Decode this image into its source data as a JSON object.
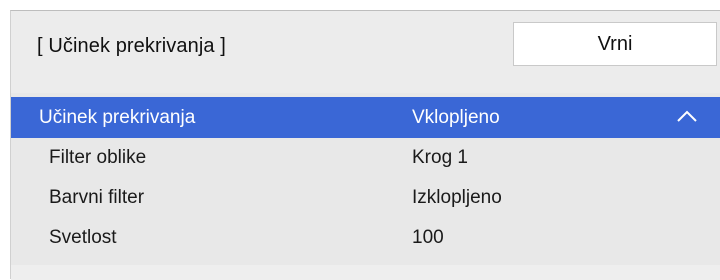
{
  "header": {
    "title": "[ Učinek prekrivanja ]",
    "back_label": "Vrni"
  },
  "rows": [
    {
      "label": "Učinek prekrivanja",
      "value": "Vklopljeno",
      "selected": true,
      "icon": "chevron-up-icon"
    },
    {
      "label": "Filter oblike",
      "value": "Krog 1",
      "selected": false
    },
    {
      "label": "Barvni filter",
      "value": "Izklopljeno",
      "selected": false
    },
    {
      "label": "Svetlost",
      "value": "100",
      "selected": false
    }
  ],
  "colors": {
    "selected_row": "#3a67d6",
    "panel_background": "#e8e8e8",
    "button_background": "#ffffff"
  }
}
